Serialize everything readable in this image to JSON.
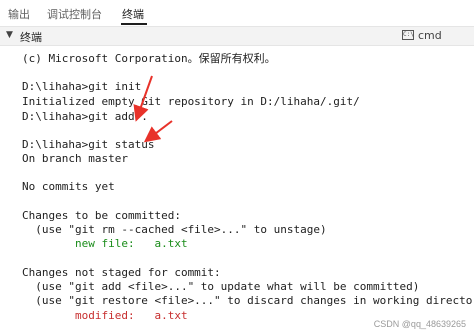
{
  "tabs": [
    {
      "label": "输出"
    },
    {
      "label": "调试控制台"
    },
    {
      "label": "终端"
    }
  ],
  "panel": {
    "title": "终端",
    "shell_label": "cmd",
    "shell_icon": "terminal-icon",
    "collapse_icon": "chevron-down-icon"
  },
  "terminal": {
    "lines": [
      {
        "text": "(c) Microsoft Corporation。保留所有权利。"
      },
      {
        "text": "D:\\lihaha>git init"
      },
      {
        "text": "Initialized empty Git repository in D:/lihaha/.git/"
      },
      {
        "text": "D:\\lihaha>git add ."
      },
      {
        "text": "D:\\lihaha>git status"
      },
      {
        "text": "On branch master"
      },
      {
        "text": "No commits yet"
      },
      {
        "text": "Changes to be committed:"
      },
      {
        "text": "  (use \"git rm --cached <file>...\" to unstage)"
      },
      {
        "text": "        new file:   a.txt",
        "color": "green"
      },
      {
        "text": "Changes not staged for commit:"
      },
      {
        "text": "  (use \"git add <file>...\" to update what will be committed)"
      },
      {
        "text": "  (use \"git restore <file>...\" to discard changes in working directory)"
      },
      {
        "text": "        modified:   a.txt",
        "color": "red"
      }
    ]
  },
  "colors": {
    "green": "#1a8c1a",
    "red": "#c72e2e",
    "arrow": "#e8322a"
  },
  "watermark": "CSDN @qq_48639265"
}
